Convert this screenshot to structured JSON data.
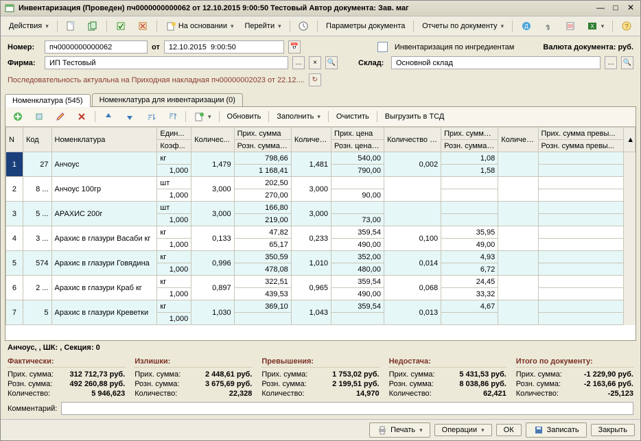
{
  "window_title": "Инвентаризация (Проведен)  пч0000000000062 от 12.10.2015 9:00:50 Тестовый Автор документа: Зав. маг",
  "toolbar": {
    "actions": "Действия",
    "based_on": "На основании",
    "goto": "Перейти",
    "doc_params": "Параметры документа",
    "doc_reports": "Отчеты по документу"
  },
  "form": {
    "number_label": "Номер:",
    "number_value": "пч0000000000062",
    "from_label": "от",
    "date_value": "12.10.2015  9:00:50",
    "ingredients_label": "Инвентаризация по ингредиентам",
    "currency_label": "Валюта документа: руб.",
    "firm_label": "Фирма:",
    "firm_value": "ИП Тестовый",
    "store_label": "Склад:",
    "store_value": "Основной склад",
    "sequence_text": "Последовательность актуальна на Приходная накладная пч00000002023 от 22.12...."
  },
  "tabs": {
    "tab1": "Номенклатура (545)",
    "tab2": "Номенклатура для инвентаризации (0)"
  },
  "tab_toolbar": {
    "refresh": "Обновить",
    "fill": "Заполнить",
    "clear": "Очистить",
    "export_tsd": "Выгрузить в ТСД"
  },
  "grid": {
    "headers": {
      "n": "N",
      "code": "Код",
      "name": "Номенклатура",
      "unit": "Един...",
      "coef": "Коэф...",
      "qty": "Количес...",
      "psum": "Прих. сумма",
      "rsum": "Розн. сумма (...",
      "qty_fact": "Количе... факт",
      "pprice": "Прих. цена",
      "rprice": "Розн. цена (...",
      "qty_diff": "Количество расхожде...",
      "psum_d": "Прих. сумма ...",
      "rsum_d": "Розн. сумма ...",
      "qty_exc": "Количес... превыш...",
      "psum_e": "Прих. сумма превы...",
      "rsum_e": "Розн. сумма превы..."
    },
    "rows": [
      {
        "n": "1",
        "code": "27",
        "name": "Анчоус",
        "unit": "кг",
        "coef": "1,000",
        "qty": "1,479",
        "psum": "798,66",
        "rsum": "1 168,41",
        "qf": "1,481",
        "pprice": "540,00",
        "rprice": "790,00",
        "qd": "0,002",
        "psd": "1,08",
        "rsd": "1,58",
        "qe": "",
        "pse": ""
      },
      {
        "n": "2",
        "code": "8 ...",
        "name": "Анчоус 100гр",
        "unit": "шт",
        "coef": "1,000",
        "qty": "3,000",
        "psum": "202,50",
        "rsum": "270,00",
        "qf": "3,000",
        "pprice": "",
        "rprice": "90,00",
        "qd": "",
        "psd": "",
        "rsd": "",
        "qe": "",
        "pse": ""
      },
      {
        "n": "3",
        "code": "5 ...",
        "name": "АРАХИС 200г",
        "unit": "шт",
        "coef": "1,000",
        "qty": "3,000",
        "psum": "166,80",
        "rsum": "219,00",
        "qf": "3,000",
        "pprice": "",
        "rprice": "73,00",
        "qd": "",
        "psd": "",
        "rsd": "",
        "qe": "",
        "pse": ""
      },
      {
        "n": "4",
        "code": "3 ...",
        "name": "Арахис в глазури Васаби кг",
        "unit": "кг",
        "coef": "1,000",
        "qty": "0,133",
        "psum": "47,82",
        "rsum": "65,17",
        "qf": "0,233",
        "pprice": "359,54",
        "rprice": "490,00",
        "qd": "0,100",
        "psd": "35,95",
        "rsd": "49,00",
        "qe": "",
        "pse": ""
      },
      {
        "n": "5",
        "code": "574",
        "name": "Арахис в глазури Говядина",
        "unit": "кг",
        "coef": "1,000",
        "qty": "0,996",
        "psum": "350,59",
        "rsum": "478,08",
        "qf": "1,010",
        "pprice": "352,00",
        "rprice": "480,00",
        "qd": "0,014",
        "psd": "4,93",
        "rsd": "6,72",
        "qe": "",
        "pse": ""
      },
      {
        "n": "6",
        "code": "2 ...",
        "name": "Арахис в глазури Краб кг",
        "unit": "кг",
        "coef": "1,000",
        "qty": "0,897",
        "psum": "322,51",
        "rsum": "439,53",
        "qf": "0,965",
        "pprice": "359,54",
        "rprice": "490,00",
        "qd": "0,068",
        "psd": "24,45",
        "rsd": "33,32",
        "qe": "",
        "pse": ""
      },
      {
        "n": "7",
        "code": "5",
        "name": "Арахис в глазури Креветки",
        "unit": "кг",
        "coef": "1,000",
        "qty": "1,030",
        "psum": "369,10",
        "rsum": "",
        "qf": "1,043",
        "pprice": "359,54",
        "rprice": "",
        "qd": "0,013",
        "psd": "4,67",
        "rsd": "",
        "qe": "",
        "pse": ""
      }
    ]
  },
  "info_strip": "Анчоус, , ШК: , Секция:  0",
  "summary": {
    "cols": {
      "fact": "Фактически:",
      "excess": "Излишки:",
      "over": "Превышения:",
      "short": "Недостача:",
      "total": "Итого по документу:"
    },
    "labels": {
      "psum": "Прих. сумма:",
      "rsum": "Розн. сумма:",
      "qty": "Количество:"
    },
    "fact": {
      "psum": "312 712,73 руб.",
      "rsum": "492 260,88 руб.",
      "qty": "5 946,623"
    },
    "excess": {
      "psum": "2 448,61 руб.",
      "rsum": "3 675,69 руб.",
      "qty": "22,328"
    },
    "over": {
      "psum": "1 753,02 руб.",
      "rsum": "2 199,51 руб.",
      "qty": "14,970"
    },
    "short": {
      "psum": "5 431,53 руб.",
      "rsum": "8 038,86 руб.",
      "qty": "62,421"
    },
    "total": {
      "psum": "-1 229,90 руб.",
      "rsum": "-2 163,66 руб.",
      "qty": "-25,123"
    }
  },
  "comment_label": "Комментарий:",
  "footer": {
    "print": "Печать",
    "ops": "Операции",
    "ok": "ОК",
    "save": "Записать",
    "close": "Закрыть"
  }
}
